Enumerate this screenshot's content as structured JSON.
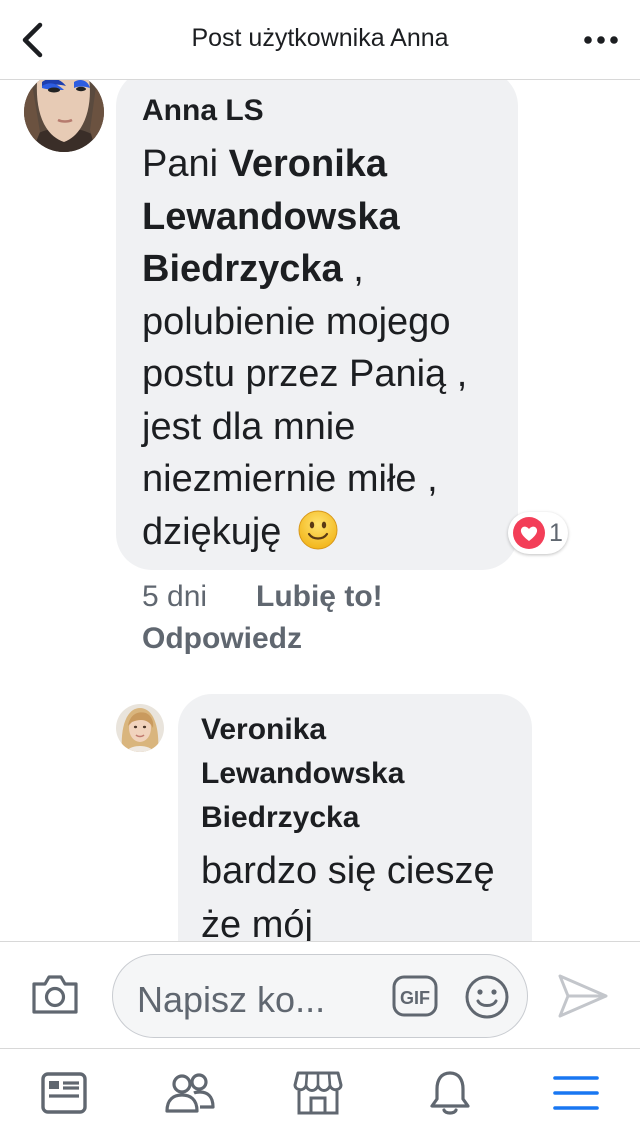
{
  "header": {
    "title": "Post użytkownika Anna",
    "back_icon": "chevron-left-icon",
    "more_icon": "more-icon"
  },
  "comments": [
    {
      "author": "Anna LS",
      "text_parts": [
        "Pani ",
        "Veronika Lewandowska Biedrzycka",
        " , polubienie mojego postu przez Panią , jest dla mnie niezmiernie miłe , dziękuję"
      ],
      "emoji": "smile-emoji",
      "reaction_count": "1",
      "reaction_icon": "heart-icon",
      "time": "5 dni",
      "like_label": "Lubię to!",
      "reply_label": "Odpowiedz"
    },
    {
      "author": "Veronika Lewandowska Biedrzycka",
      "text": "bardzo się cieszę że mój"
    }
  ],
  "composer": {
    "placeholder": "Napisz ko...",
    "camera_icon": "camera-icon",
    "gif_icon": "gif-icon",
    "emoji_icon": "emoji-icon",
    "send_icon": "send-icon"
  },
  "tabs": [
    {
      "icon": "news-feed-icon",
      "active": false
    },
    {
      "icon": "friends-icon",
      "active": false
    },
    {
      "icon": "marketplace-icon",
      "active": false
    },
    {
      "icon": "bell-icon",
      "active": false
    },
    {
      "icon": "menu-icon",
      "active": true
    }
  ],
  "colors": {
    "accent": "#1877f2",
    "bubble": "#f0f1f3",
    "meta_text": "#606770",
    "heart": "#f33e58",
    "icon_gray": "#606770"
  }
}
